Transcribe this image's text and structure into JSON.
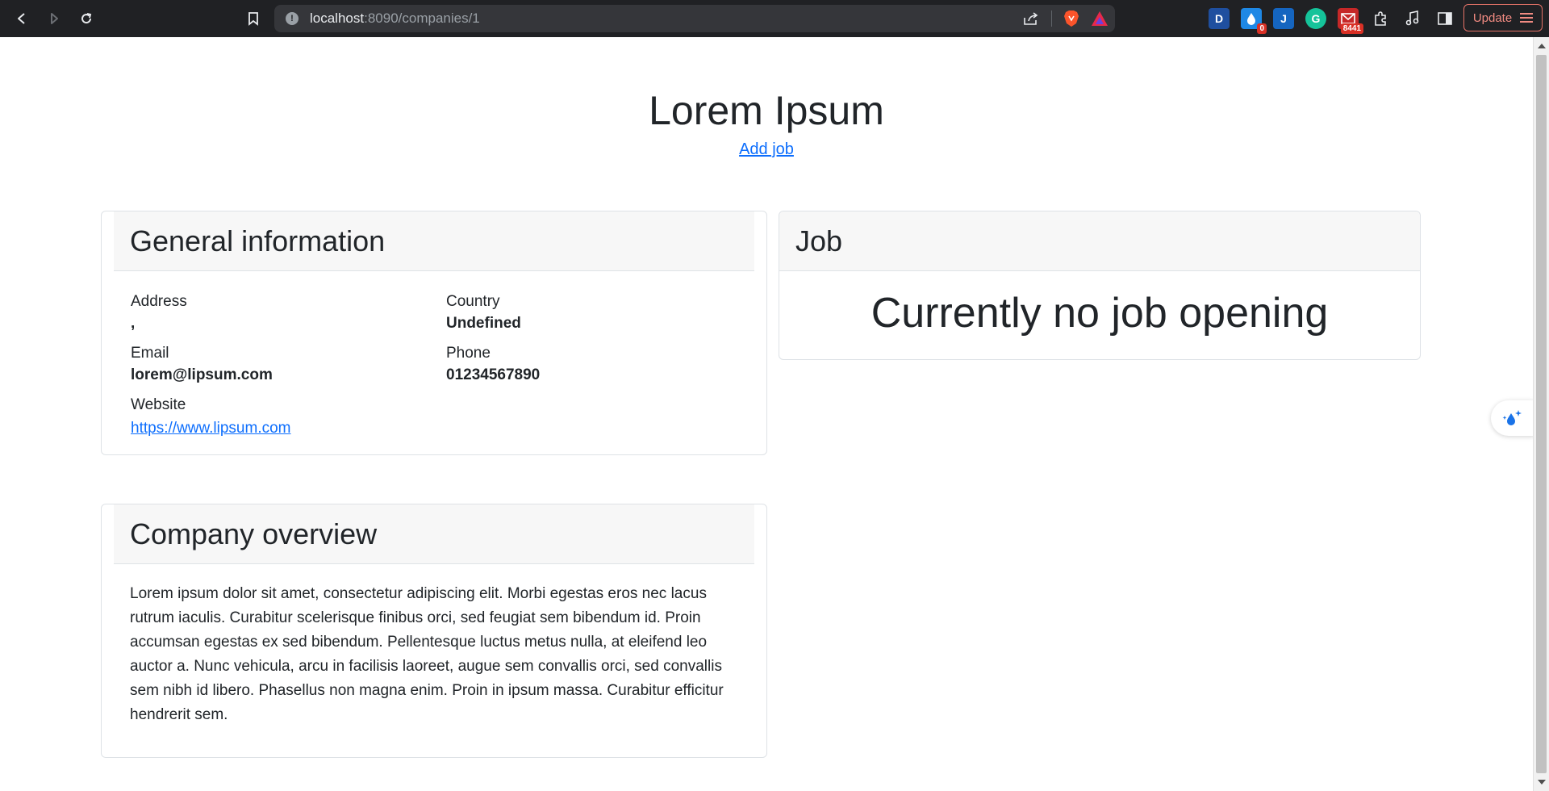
{
  "browser": {
    "url_host": "localhost",
    "url_path": ":8090/companies/1",
    "update_label": "Update",
    "extensions": [
      {
        "icon": "dashlane-icon",
        "letter": "D",
        "color": "#1f4f9f",
        "badge": ""
      },
      {
        "icon": "droplet-ext-icon",
        "letter": "",
        "color": "#1e88e5",
        "badge": "0"
      },
      {
        "icon": "j-ext-icon",
        "letter": "J",
        "color": "#1565c0",
        "badge": ""
      },
      {
        "icon": "grammarly-icon",
        "letter": "G",
        "color": "#15c39a",
        "badge": ""
      },
      {
        "icon": "mail-ext-icon",
        "letter": "",
        "color": "#c62828",
        "badge": "8441"
      }
    ]
  },
  "page": {
    "title": "Lorem Ipsum",
    "add_job_label": "Add job"
  },
  "general": {
    "heading": "General information",
    "address_label": "Address",
    "address_value": ",",
    "country_label": "Country",
    "country_value": "Undefined",
    "email_label": "Email",
    "email_value": "lorem@lipsum.com",
    "phone_label": "Phone",
    "phone_value": "01234567890",
    "website_label": "Website",
    "website_value": "https://www.lipsum.com"
  },
  "job": {
    "heading": "Job",
    "empty_message": "Currently no job opening"
  },
  "overview": {
    "heading": "Company overview",
    "text": "Lorem ipsum dolor sit amet, consectetur adipiscing elit. Morbi egestas eros nec lacus rutrum iaculis. Curabitur scelerisque finibus orci, sed feugiat sem bibendum id. Proin accumsan egestas ex sed bibendum. Pellentesque luctus metus nulla, at eleifend leo auctor a. Nunc vehicula, arcu in facilisis laoreet, augue sem convallis orci, sed convallis sem nibh id libero. Phasellus non magna enim. Proin in ipsum massa. Curabitur efficitur hendrerit sem."
  },
  "colors": {
    "link": "#0d6efd",
    "chrome_bg": "#202124",
    "card_header_bg": "#f7f7f7"
  }
}
